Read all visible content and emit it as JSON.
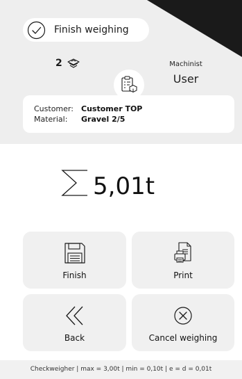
{
  "header": {
    "finish_weighing_label": "Finish weighing",
    "count": "2",
    "machinist_label": "Machinist",
    "machinist_name": "User"
  },
  "info": {
    "customer_label": "Customer:",
    "customer_value": "Customer TOP",
    "material_label": "Material:",
    "material_value": "Gravel 2/5"
  },
  "total": {
    "value": "5,01t"
  },
  "buttons": {
    "finish": "Finish",
    "print": "Print",
    "back": "Back",
    "cancel": "Cancel weighing"
  },
  "footer": {
    "text": "Checkweigher | max = 3,00t | min = 0,10t | e = d = 0,01t"
  },
  "icons": {
    "finish_weighing": "check-circle-icon",
    "count": "truck-icon",
    "info": "clipboard-box-icon",
    "total": "sigma-icon",
    "finish": "floppy-disk-icon",
    "print": "printer-document-icon",
    "back": "double-chevron-left-icon",
    "cancel": "x-circle-icon"
  },
  "colors": {
    "background": "#ffffff",
    "panel": "#eeeeee",
    "button": "#f0f0f0",
    "corner": "#1a1a1a",
    "text": "#1a1a1a"
  }
}
